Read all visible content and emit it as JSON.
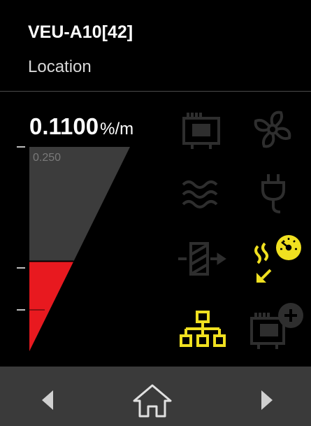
{
  "header": {
    "device_name": "VEU-A10[42]",
    "subtitle": "Location"
  },
  "reading": {
    "value": "0.1100",
    "unit": "%/m"
  },
  "gauge": {
    "max_label": "0.250",
    "max": 0.25,
    "value": 0.11,
    "fill_color": "#e8191f",
    "track_color": "#3c3c3c"
  },
  "icons": [
    {
      "name": "control-panel-icon",
      "state": "inactive"
    },
    {
      "name": "fan-icon",
      "state": "inactive"
    },
    {
      "name": "heat-waves-icon",
      "state": "inactive"
    },
    {
      "name": "power-plug-icon",
      "state": "inactive"
    },
    {
      "name": "filter-flow-icon",
      "state": "inactive"
    },
    {
      "name": "smoke-detector-gauge-icon",
      "state": "active"
    },
    {
      "name": "network-icon",
      "state": "active"
    },
    {
      "name": "add-module-icon",
      "state": "inactive"
    }
  ],
  "colors": {
    "active_icon": "#f0e020",
    "inactive_icon": "#2e2e2e",
    "footer_bg": "#3a3a3a"
  },
  "footer": {
    "prev_icon": "triangle-left-icon",
    "home_icon": "home-icon",
    "next_icon": "triangle-right-icon"
  }
}
